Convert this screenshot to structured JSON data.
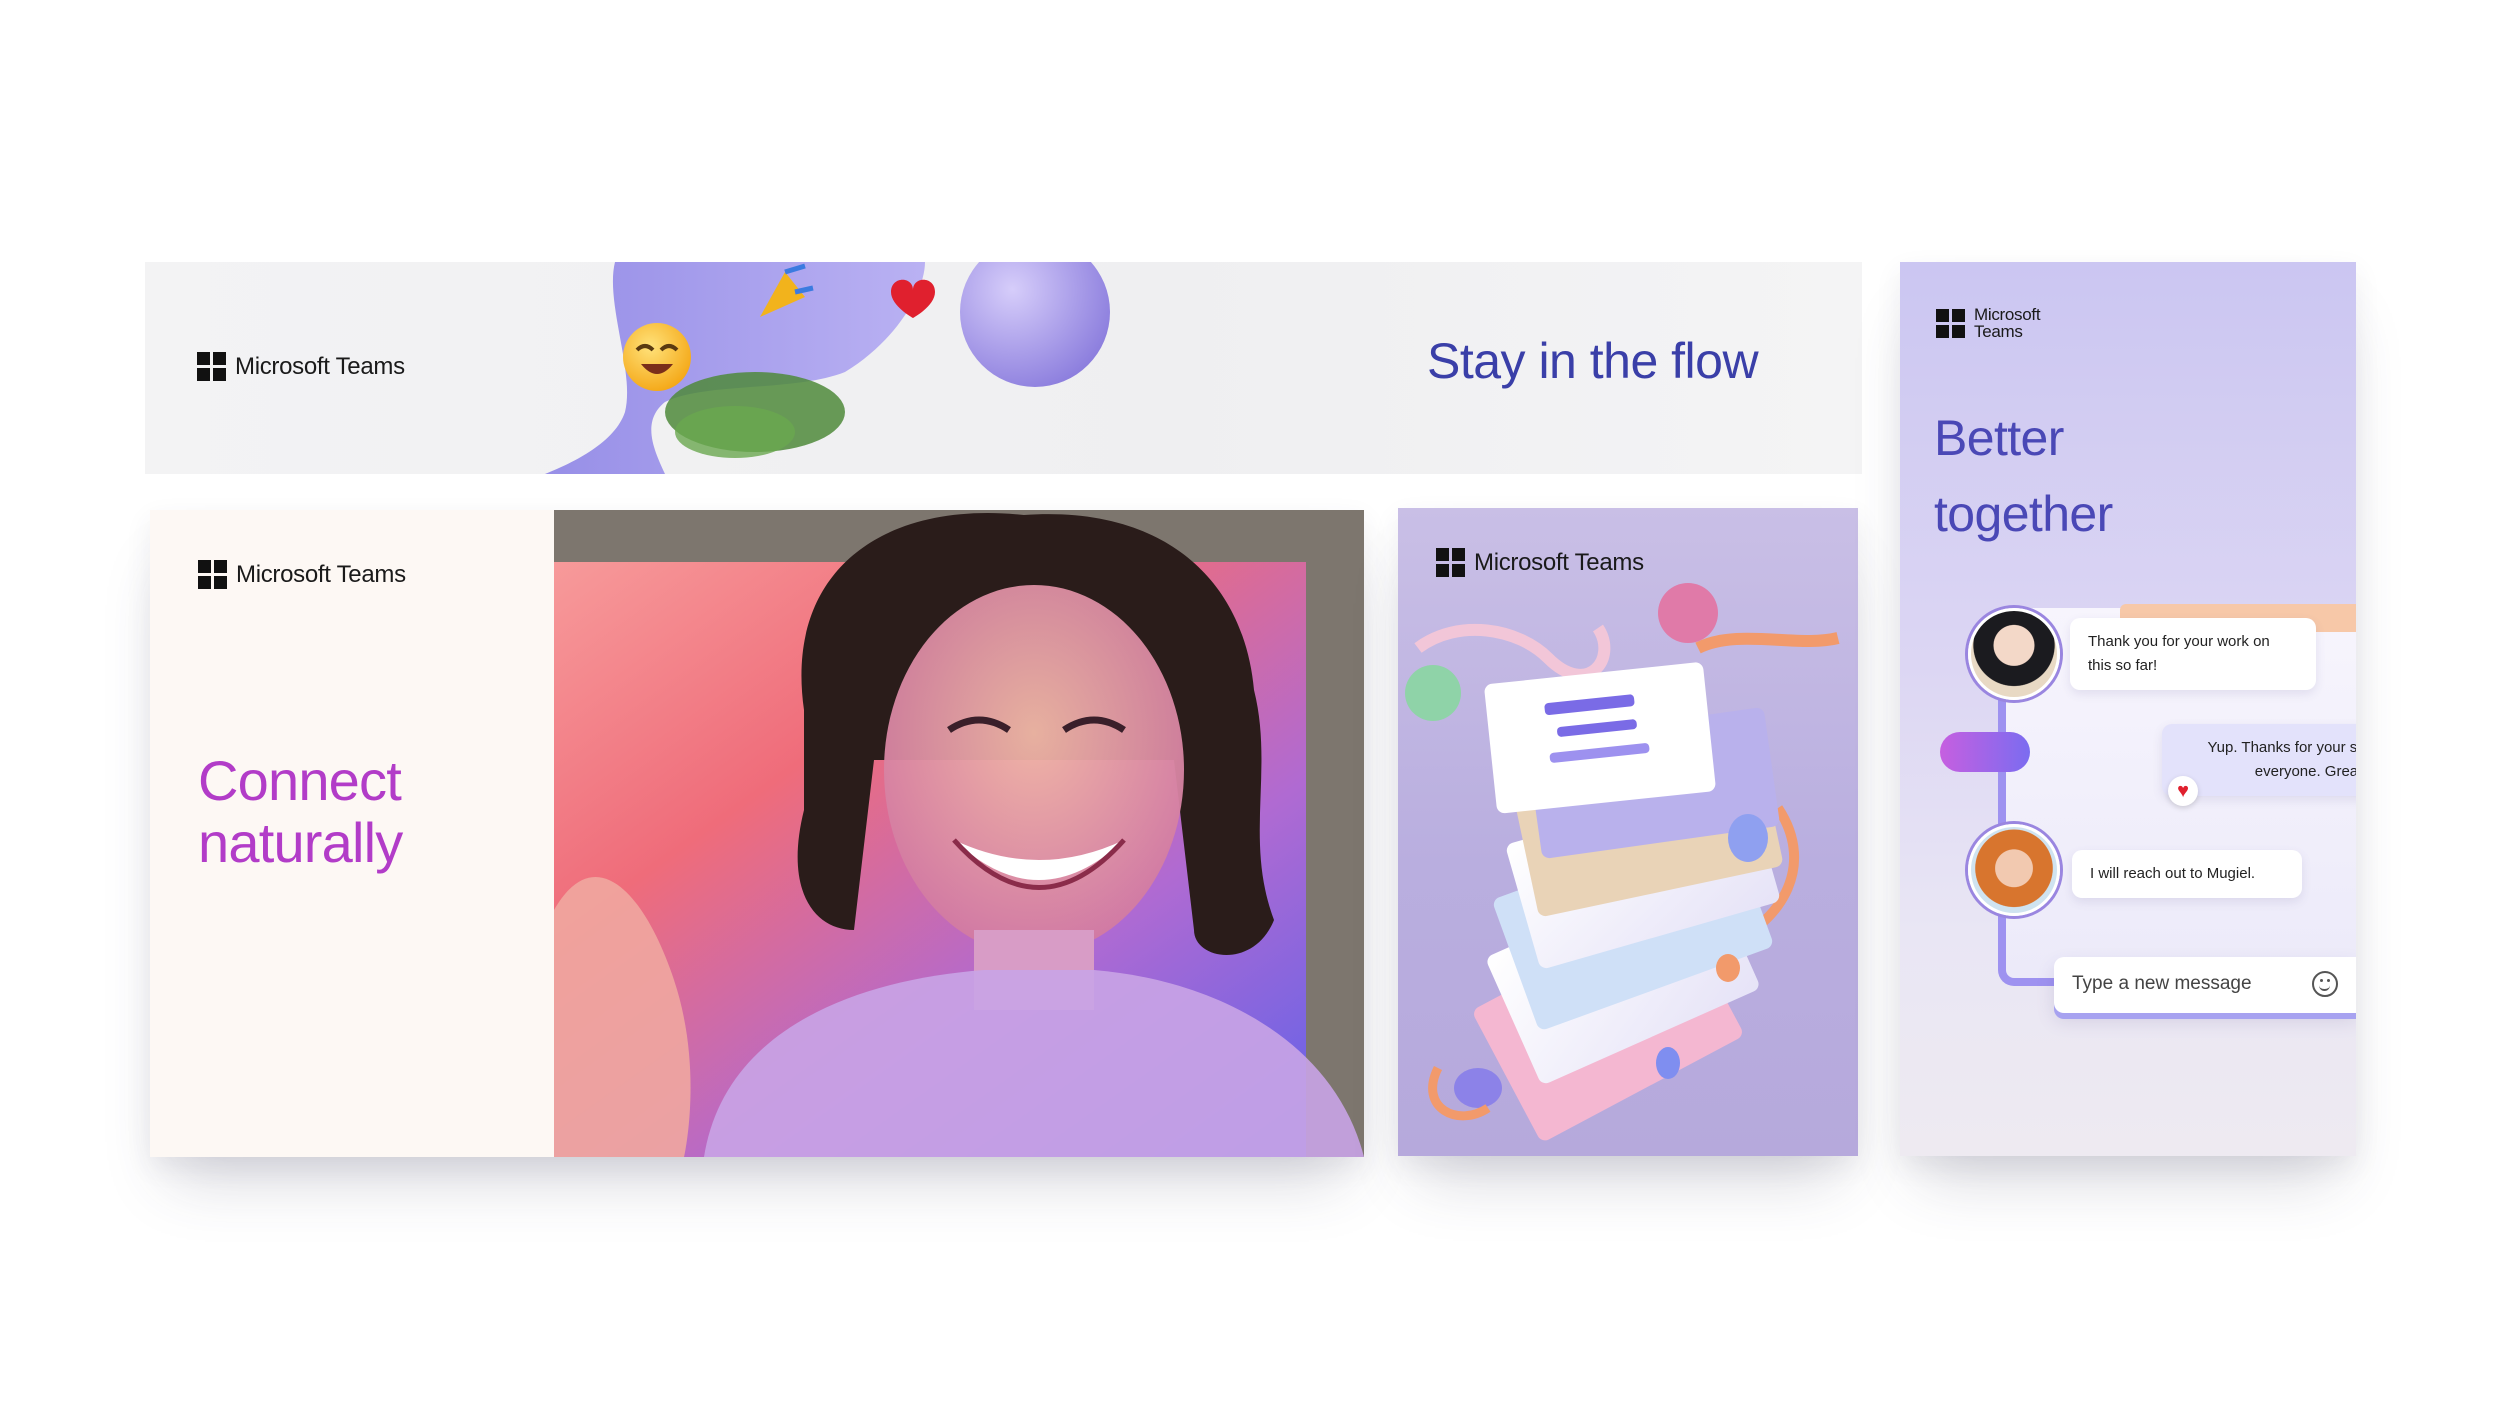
{
  "brand": {
    "logo_text": "Microsoft Teams",
    "logo_line1": "Microsoft",
    "logo_line2": "Teams"
  },
  "banner": {
    "title": "Stay in the flow",
    "title_color": "#3a3fa8"
  },
  "connect_card": {
    "headline_line1": "Connect",
    "headline_line2": "naturally",
    "headline_color": "#b23cc8"
  },
  "collage_card": {
    "logo_text": "Microsoft Teams"
  },
  "better_card": {
    "headline_line1": "Better",
    "headline_line2": "together",
    "headline_color": "#4a48b6",
    "messages": [
      {
        "text_line1": "Thank you for your work on",
        "text_line2": "this so far!"
      },
      {
        "text_line1": "Yup. Thanks for your sup",
        "text_line2": "everyone. Great v"
      },
      {
        "text_line1": "I will reach out to Mugiel."
      }
    ],
    "compose_placeholder": "Type a new message"
  }
}
